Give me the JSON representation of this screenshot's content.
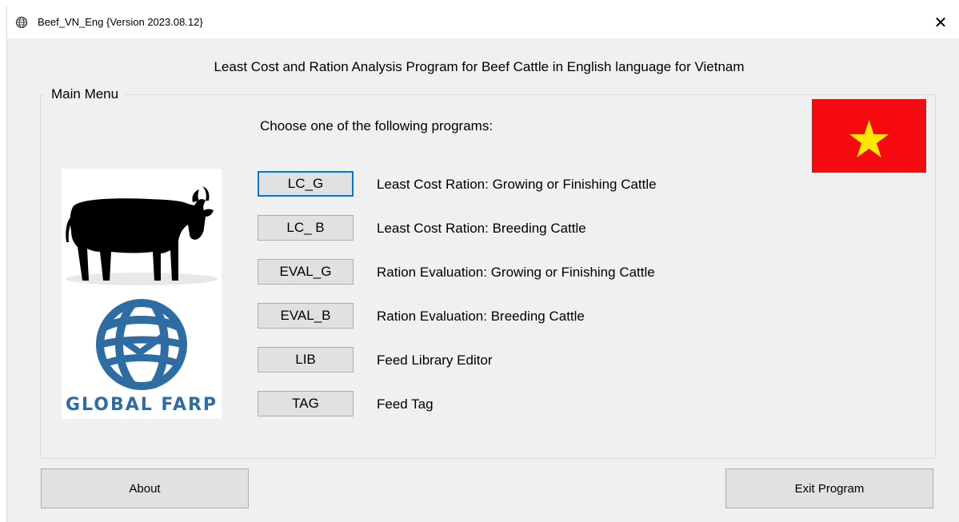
{
  "window": {
    "title": "Beef_VN_Eng {Version 2023.08.12}",
    "close_glyph": "✕",
    "app_icon": "globe-icon"
  },
  "header": {
    "title": "Least Cost and Ration Analysis Program for Beef Cattle in English language for Vietnam"
  },
  "main_menu": {
    "group_label": "Main Menu",
    "prompt": "Choose one of the following programs:",
    "programs": [
      {
        "button": "LC_G",
        "description": "Least Cost Ration: Growing or Finishing Cattle"
      },
      {
        "button": "LC_ B",
        "description": "Least Cost Ration: Breeding Cattle"
      },
      {
        "button": "EVAL_G",
        "description": "Ration Evaluation: Growing or Finishing Cattle"
      },
      {
        "button": "EVAL_B",
        "description": "Ration Evaluation: Breeding Cattle"
      },
      {
        "button": "LIB",
        "description": "Feed Library Editor"
      },
      {
        "button": "TAG",
        "description": "Feed Tag"
      }
    ]
  },
  "logo": {
    "text": "GLOBAL FARP",
    "icons": [
      "cow-icon",
      "globe-icon"
    ]
  },
  "flag": {
    "name": "vietnam-flag",
    "background": "#f50a10",
    "star_color": "#ffe600"
  },
  "footer": {
    "about_label": "About",
    "exit_label": "Exit Program"
  },
  "colors": {
    "window_bg": "#f0f0f0",
    "button_bg": "#e1e1e1",
    "button_border": "#adadad",
    "focus_border": "#0078d7",
    "logo_blue": "#2e6da4"
  }
}
